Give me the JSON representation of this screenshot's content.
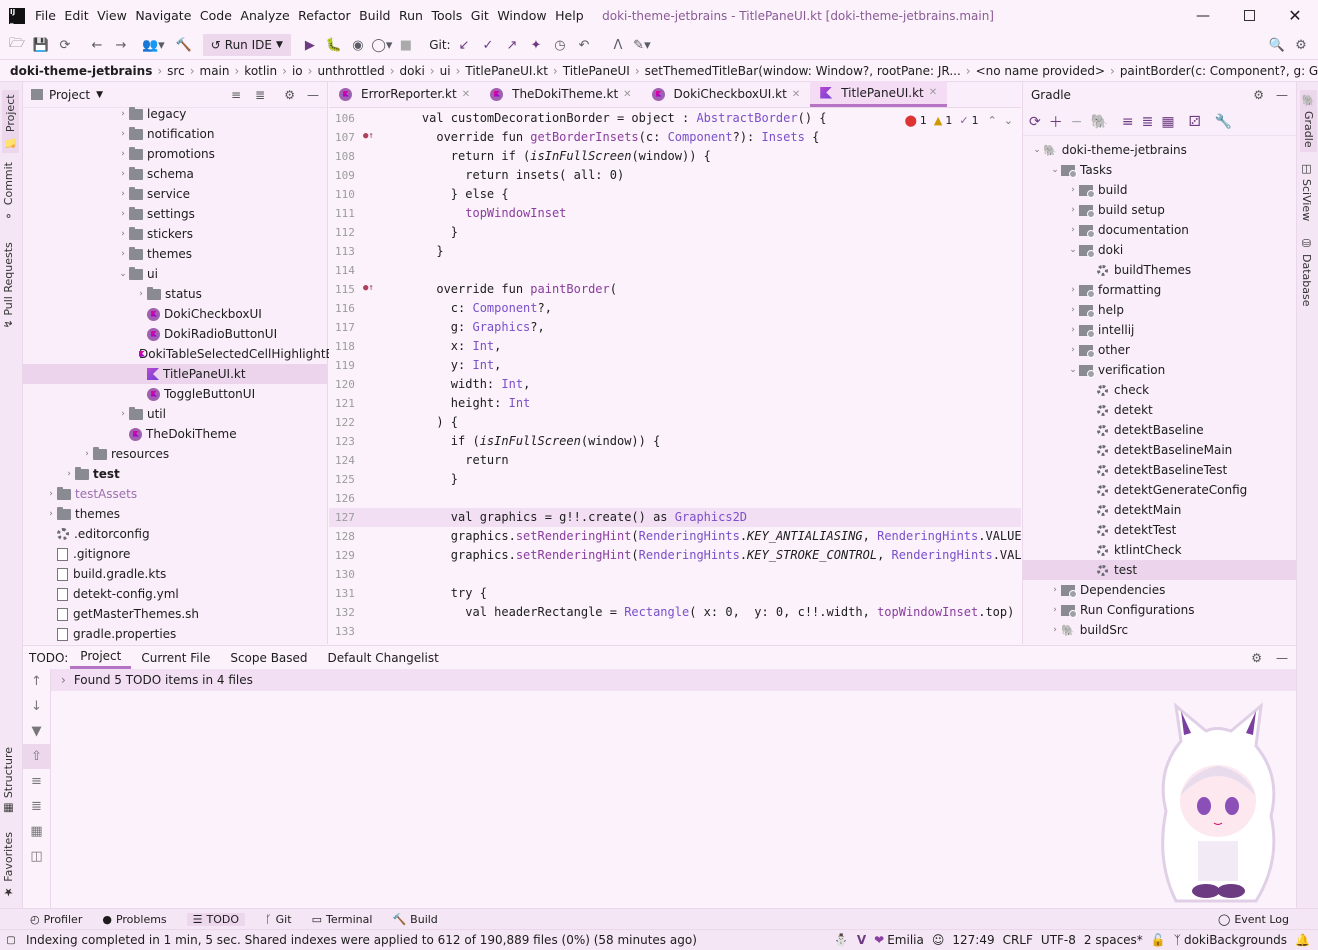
{
  "window": {
    "title": "doki-theme-jetbrains - TitlePaneUI.kt [doki-theme-jetbrains.main]",
    "menu": [
      "File",
      "Edit",
      "View",
      "Navigate",
      "Code",
      "Analyze",
      "Refactor",
      "Build",
      "Run",
      "Tools",
      "Git",
      "Window",
      "Help"
    ]
  },
  "toolbar": {
    "run_config": "Run IDE",
    "git_label": "Git:"
  },
  "breadcrumb": [
    "doki-theme-jetbrains",
    "src",
    "main",
    "kotlin",
    "io",
    "unthrottled",
    "doki",
    "ui",
    "TitlePaneUI.kt",
    "TitlePaneUI",
    "setThemedTitleBar(window: Window?, rootPane: JR...",
    "<no name provided>",
    "paintBorder(c: Component?, g: Graphics"
  ],
  "left_strip": {
    "project": "Project",
    "commit": "Commit",
    "pull_requests": "Pull Requests",
    "structure": "Structure",
    "favorites": "Favorites"
  },
  "right_strip": {
    "gradle": "Gradle",
    "sciview": "SciView",
    "database": "Database"
  },
  "project_panel": {
    "title": "Project",
    "items": [
      {
        "label": "legacy",
        "depth": 5,
        "type": "folder",
        "arrow": "›"
      },
      {
        "label": "notification",
        "depth": 5,
        "type": "folder",
        "arrow": "›"
      },
      {
        "label": "promotions",
        "depth": 5,
        "type": "folder",
        "arrow": "›"
      },
      {
        "label": "schema",
        "depth": 5,
        "type": "folder",
        "arrow": "›"
      },
      {
        "label": "service",
        "depth": 5,
        "type": "folder",
        "arrow": "›"
      },
      {
        "label": "settings",
        "depth": 5,
        "type": "folder",
        "arrow": "›"
      },
      {
        "label": "stickers",
        "depth": 5,
        "type": "folder",
        "arrow": "›"
      },
      {
        "label": "themes",
        "depth": 5,
        "type": "folder",
        "arrow": "›"
      },
      {
        "label": "ui",
        "depth": 5,
        "type": "folder",
        "arrow": "⌄"
      },
      {
        "label": "status",
        "depth": 6,
        "type": "folder",
        "arrow": "›"
      },
      {
        "label": "DokiCheckboxUI",
        "depth": 6,
        "type": "kt",
        "arrow": ""
      },
      {
        "label": "DokiRadioButtonUI",
        "depth": 6,
        "type": "kt",
        "arrow": ""
      },
      {
        "label": "DokiTableSelectedCellHighlightBorder",
        "depth": 6,
        "type": "kt",
        "arrow": ""
      },
      {
        "label": "TitlePaneUI.kt",
        "depth": 6,
        "type": "ktf",
        "arrow": ""
      },
      {
        "label": "ToggleButtonUI",
        "depth": 6,
        "type": "kt",
        "arrow": ""
      },
      {
        "label": "util",
        "depth": 5,
        "type": "folder",
        "arrow": "›"
      },
      {
        "label": "TheDokiTheme",
        "depth": 5,
        "type": "kt",
        "arrow": ""
      },
      {
        "label": "resources",
        "depth": 3,
        "type": "folder",
        "arrow": "›"
      },
      {
        "label": "test",
        "depth": 2,
        "type": "folder",
        "arrow": "›"
      },
      {
        "label": "testAssets",
        "depth": 1,
        "type": "folder",
        "arrow": "›"
      },
      {
        "label": "themes",
        "depth": 1,
        "type": "folder",
        "arrow": "›"
      },
      {
        "label": ".editorconfig",
        "depth": 1,
        "type": "gear",
        "arrow": ""
      },
      {
        "label": ".gitignore",
        "depth": 1,
        "type": "file",
        "arrow": ""
      },
      {
        "label": "build.gradle.kts",
        "depth": 1,
        "type": "file",
        "arrow": ""
      },
      {
        "label": "detekt-config.yml",
        "depth": 1,
        "type": "file",
        "arrow": ""
      },
      {
        "label": "getMasterThemes.sh",
        "depth": 1,
        "type": "file",
        "arrow": ""
      },
      {
        "label": "gradle.properties",
        "depth": 1,
        "type": "file",
        "arrow": ""
      }
    ]
  },
  "editor": {
    "tabs": [
      {
        "label": "ErrorReporter.kt",
        "active": false
      },
      {
        "label": "TheDokiTheme.kt",
        "active": false
      },
      {
        "label": "DokiCheckboxUI.kt",
        "active": false
      },
      {
        "label": "TitlePaneUI.kt",
        "active": true
      }
    ],
    "inspections": {
      "errors": "1",
      "warnings": "1",
      "weak": "1"
    },
    "line_numbers": [
      "106",
      "107",
      "108",
      "109",
      "110",
      "111",
      "112",
      "113",
      "114",
      "115",
      "116",
      "117",
      "118",
      "119",
      "120",
      "121",
      "122",
      "123",
      "124",
      "125",
      "126",
      "127",
      "128",
      "129",
      "130",
      "131",
      "132",
      "133"
    ],
    "code": [
      "    val customDecorationBorder = object : AbstractBorder() {",
      "      override fun getBorderInsets(c: Component?): Insets {",
      "        return if (isInFullScreen(window)) {",
      "          return insets( all: 0)",
      "        } else {",
      "          topWindowInset",
      "        }",
      "      }",
      "",
      "      override fun paintBorder(",
      "        c: Component?,",
      "        g: Graphics?,",
      "        x: Int,",
      "        y: Int,",
      "        width: Int,",
      "        height: Int",
      "      ) {",
      "        if (isInFullScreen(window)) {",
      "          return",
      "        }",
      "",
      "        val graphics = g!!.create() as Graphics2D",
      "        graphics.setRenderingHint(RenderingHints.KEY_ANTIALIASING, RenderingHints.VALUE_A",
      "        graphics.setRenderingHint(RenderingHints.KEY_STROKE_CONTROL, RenderingHints.VALUE",
      "",
      "        try {",
      "          val headerRectangle = Rectangle( x: 0,  y: 0, c!!.width, topWindowInset.top)",
      ""
    ]
  },
  "gradle_panel": {
    "title": "Gradle",
    "items": [
      {
        "label": "doki-theme-jetbrains",
        "depth": 0,
        "type": "root",
        "arrow": "⌄"
      },
      {
        "label": "Tasks",
        "depth": 1,
        "type": "folder",
        "arrow": "⌄"
      },
      {
        "label": "build",
        "depth": 2,
        "type": "folder",
        "arrow": "›"
      },
      {
        "label": "build setup",
        "depth": 2,
        "type": "folder",
        "arrow": "›"
      },
      {
        "label": "documentation",
        "depth": 2,
        "type": "folder",
        "arrow": "›"
      },
      {
        "label": "doki",
        "depth": 2,
        "type": "folder",
        "arrow": "⌄"
      },
      {
        "label": "buildThemes",
        "depth": 3,
        "type": "task",
        "arrow": ""
      },
      {
        "label": "formatting",
        "depth": 2,
        "type": "folder",
        "arrow": "›"
      },
      {
        "label": "help",
        "depth": 2,
        "type": "folder",
        "arrow": "›"
      },
      {
        "label": "intellij",
        "depth": 2,
        "type": "folder",
        "arrow": "›"
      },
      {
        "label": "other",
        "depth": 2,
        "type": "folder",
        "arrow": "›"
      },
      {
        "label": "verification",
        "depth": 2,
        "type": "folder",
        "arrow": "⌄"
      },
      {
        "label": "check",
        "depth": 3,
        "type": "task",
        "arrow": ""
      },
      {
        "label": "detekt",
        "depth": 3,
        "type": "task",
        "arrow": ""
      },
      {
        "label": "detektBaseline",
        "depth": 3,
        "type": "task",
        "arrow": ""
      },
      {
        "label": "detektBaselineMain",
        "depth": 3,
        "type": "task",
        "arrow": ""
      },
      {
        "label": "detektBaselineTest",
        "depth": 3,
        "type": "task",
        "arrow": ""
      },
      {
        "label": "detektGenerateConfig",
        "depth": 3,
        "type": "task",
        "arrow": ""
      },
      {
        "label": "detektMain",
        "depth": 3,
        "type": "task",
        "arrow": ""
      },
      {
        "label": "detektTest",
        "depth": 3,
        "type": "task",
        "arrow": ""
      },
      {
        "label": "ktlintCheck",
        "depth": 3,
        "type": "task",
        "arrow": ""
      },
      {
        "label": "test",
        "depth": 3,
        "type": "task",
        "arrow": ""
      },
      {
        "label": "Dependencies",
        "depth": 1,
        "type": "folder",
        "arrow": "›"
      },
      {
        "label": "Run Configurations",
        "depth": 1,
        "type": "folder",
        "arrow": "›"
      },
      {
        "label": "buildSrc",
        "depth": 1,
        "type": "root",
        "arrow": "›"
      }
    ]
  },
  "todo_panel": {
    "label": "TODO:",
    "tabs": [
      "Project",
      "Current File",
      "Scope Based",
      "Default Changelist"
    ],
    "active_tab": "Project",
    "summary": "Found 5 TODO items in 4 files"
  },
  "bottom_tools": [
    {
      "label": "Profiler",
      "icon": "profiler-icon"
    },
    {
      "label": "Problems",
      "icon": "problems-icon"
    },
    {
      "label": "TODO",
      "icon": "todo-icon"
    },
    {
      "label": "Git",
      "icon": "git-icon"
    },
    {
      "label": "Terminal",
      "icon": "terminal-icon"
    },
    {
      "label": "Build",
      "icon": "build-icon"
    }
  ],
  "event_log": "Event Log",
  "status": {
    "message": "Indexing completed in 1 min, 5 sec. Shared indexes were applied to 612 of 190,889 files (0%) (58 minutes ago)",
    "theme": "Emilia",
    "position": "127:49",
    "line_sep": "CRLF",
    "encoding": "UTF-8",
    "indent": "2 spaces*",
    "branch": "dokiBackgrounds"
  },
  "colors": {
    "accent": "#b574c4",
    "background": "#fbf2fb",
    "panel": "#f9eef9"
  }
}
